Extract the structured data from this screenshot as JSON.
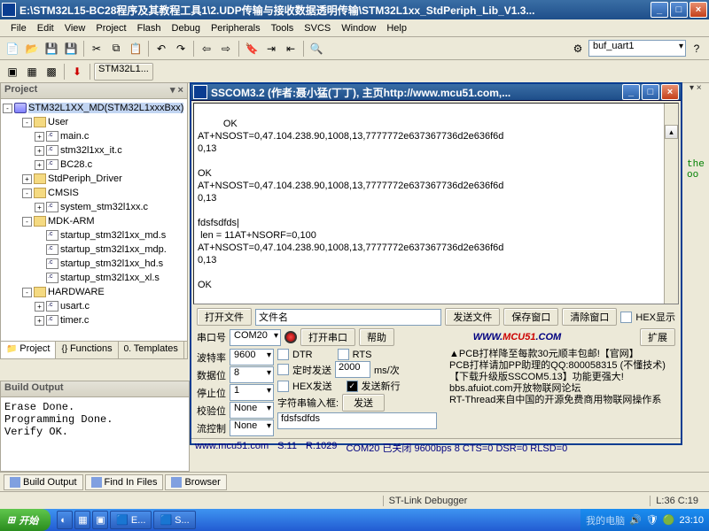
{
  "main_window": {
    "title": "E:\\STM32L15-BC28程序及其教程工具1\\2.UDP传输与接收数据透明传输\\STM32L1xx_StdPeriph_Lib_V1.3..."
  },
  "menu": {
    "file": "File",
    "edit": "Edit",
    "view": "View",
    "project": "Project",
    "flash": "Flash",
    "debug": "Debug",
    "peripherals": "Peripherals",
    "tools": "Tools",
    "svcs": "SVCS",
    "window": "Window",
    "help": "Help"
  },
  "toolbar2": {
    "combo": "buf_uart1",
    "tab": "STM32L1..."
  },
  "project": {
    "title": "Project",
    "root": "STM32L1XX_MD(STM32L1xxxBxx)",
    "nodes": [
      {
        "lvl": 1,
        "exp": "-",
        "ico": "folder",
        "label": "User"
      },
      {
        "lvl": 2,
        "exp": "+",
        "ico": "file",
        "label": "main.c"
      },
      {
        "lvl": 2,
        "exp": "+",
        "ico": "file",
        "label": "stm32l1xx_it.c"
      },
      {
        "lvl": 2,
        "exp": "+",
        "ico": "file",
        "label": "BC28.c"
      },
      {
        "lvl": 1,
        "exp": "+",
        "ico": "folder",
        "label": "StdPeriph_Driver"
      },
      {
        "lvl": 1,
        "exp": "-",
        "ico": "folder",
        "label": "CMSIS"
      },
      {
        "lvl": 2,
        "exp": "+",
        "ico": "file",
        "label": "system_stm32l1xx.c"
      },
      {
        "lvl": 1,
        "exp": "-",
        "ico": "folder",
        "label": "MDK-ARM"
      },
      {
        "lvl": 2,
        "exp": " ",
        "ico": "file",
        "label": "startup_stm32l1xx_md.s"
      },
      {
        "lvl": 2,
        "exp": " ",
        "ico": "file",
        "label": "startup_stm32l1xx_mdp."
      },
      {
        "lvl": 2,
        "exp": " ",
        "ico": "file",
        "label": "startup_stm32l1xx_hd.s"
      },
      {
        "lvl": 2,
        "exp": " ",
        "ico": "file",
        "label": "startup_stm32l1xx_xl.s"
      },
      {
        "lvl": 1,
        "exp": "-",
        "ico": "folder",
        "label": "HARDWARE"
      },
      {
        "lvl": 2,
        "exp": "+",
        "ico": "file",
        "label": "usart.c"
      },
      {
        "lvl": 2,
        "exp": "+",
        "ico": "file",
        "label": "timer.c"
      }
    ],
    "tabs": {
      "project": "Project",
      "functions": "Functions",
      "templates": "Templates"
    }
  },
  "sscom": {
    "title": "SSCOM3.2 (作者:聂小猛(丁丁), 主页http://www.mcu51.com,...",
    "terminal": "OK\nAT+NSOST=0,47.104.238.90,1008,13,7777772e637367736d2e636f6d\n0,13\n\nOK\nAT+NSOST=0,47.104.238.90,1008,13,7777772e637367736d2e636f6d\n0,13\n\nfdsfsdfds|\n len = 11AT+NSORF=0,100\nAT+NSOST=0,47.104.238.90,1008,13,7777772e637367736d2e636f6d\n0,13\n\nOK",
    "row1": {
      "openfile": "打开文件",
      "filename": "文件名",
      "sendfile": "发送文件",
      "savewin": "保存窗口",
      "clearwin": "清除窗口",
      "hexshow": "HEX显示"
    },
    "row2": {
      "comlabel": "串口号",
      "port": "COM20",
      "openport": "打开串口",
      "help": "帮助",
      "url": "WWW.MCU51.COM",
      "expand": "扩展"
    },
    "params": {
      "baud_l": "波特率",
      "baud_v": "9600",
      "data_l": "数据位",
      "data_v": "8",
      "stop_l": "停止位",
      "stop_v": "1",
      "parity_l": "校验位",
      "parity_v": "None",
      "flow_l": "流控制",
      "flow_v": "None",
      "dtr": "DTR",
      "rts": "RTS",
      "timed": "定时发送",
      "interval": "2000",
      "ms": "ms/次",
      "hexsend": "HEX发送",
      "newline": "发送新行",
      "strlabel": "字符串输入框:",
      "send": "发送",
      "strval": "fdsfsdfds"
    },
    "promo": [
      "▲PCB打样降至每款30元顺丰包邮!【官网】",
      "PCB打样请加PP助理的QQ:800058315 (不懂技术)",
      "【下载升级版SSCOM5.13】功能更强大!",
      "bbs.afuiot.com开放物联网论坛",
      "RT-Thread来自中国的开源免费商用物联网操作系"
    ],
    "status": {
      "site": "www.mcu51.com",
      "s": "S:11",
      "r": "R:1029",
      "com": "COM20 已关闭 9600bps 8 CTS=0 DSR=0 RLSD=0"
    }
  },
  "build": {
    "title": "Build Output",
    "text": "Erase Done.\nProgramming Done.\nVerify OK."
  },
  "bottom_tabs": {
    "build": "Build Output",
    "find": "Find In Files",
    "browser": "Browser"
  },
  "ide_status": {
    "debugger": "ST-Link Debugger",
    "pos": "L:36 C:19"
  },
  "taskbar": {
    "start": "开始",
    "items": [
      "E...",
      "S..."
    ],
    "tray_text": "我的电脑",
    "time": "23:10"
  },
  "side_text": "the\noo"
}
